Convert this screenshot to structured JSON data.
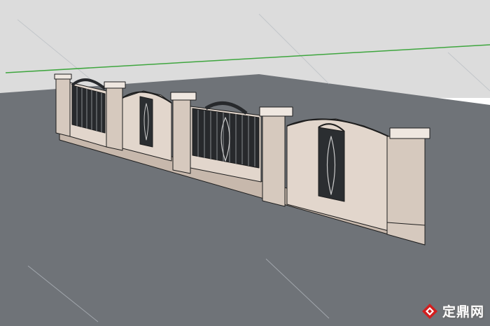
{
  "viewport": {
    "sky_color": "#dcdcdc",
    "ground_color": "#6f7378",
    "horizon_line_color": "#3fa63f",
    "axis_line_color": "#b7bcc2"
  },
  "model": {
    "stone_color": "#e2d6cc",
    "stone_shadow_color": "#c7b8ac",
    "railing_color": "#27292c",
    "outline_color": "#1e1e1e"
  },
  "watermark": {
    "text": "定鼎网",
    "icon": "diamond-logo-icon",
    "logo_color": "#d21e1e"
  }
}
